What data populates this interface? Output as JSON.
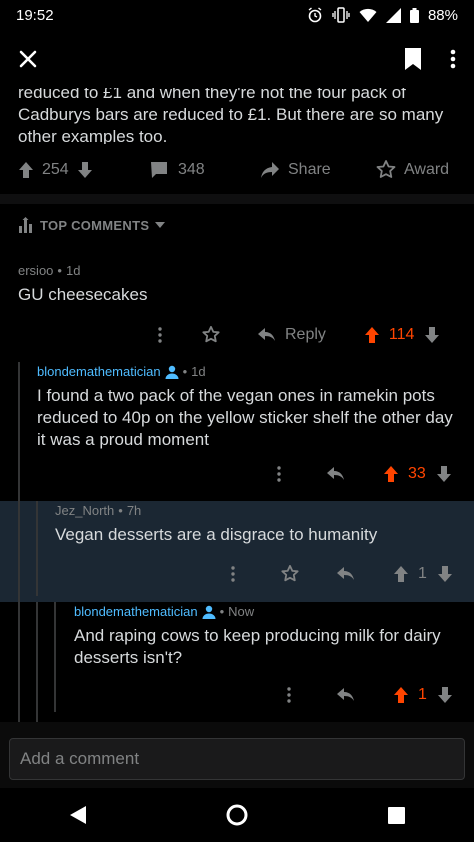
{
  "status_bar": {
    "time": "19:52",
    "battery": "88%"
  },
  "post": {
    "body_lines": [
      "reduced to £1 and when they're not the four pack of",
      "Cadburys bars are reduced to £1. But there are so many",
      "other examples too."
    ],
    "upvotes": "254",
    "comments": "348",
    "share_label": "Share",
    "award_label": "Award"
  },
  "sort": {
    "label": "TOP COMMENTS"
  },
  "comments": [
    {
      "author": "ersioo",
      "age": "1d",
      "text": "GU cheesecakes",
      "reply_label": "Reply",
      "score": "114"
    },
    {
      "author": "blondemathematician",
      "age": "1d",
      "text_lines": [
        "I found a two pack of the vegan ones in ramekin pots",
        "reduced to 40p on the yellow sticker shelf the other day",
        "it was a proud moment"
      ],
      "score": "33"
    },
    {
      "author": "Jez_North",
      "age": "7h",
      "text": "Vegan desserts are a disgrace to humanity",
      "score": "1"
    },
    {
      "author": "blondemathematician",
      "age": "Now",
      "text_lines": [
        "And raping cows to keep producing milk for dairy",
        "desserts isn't?"
      ],
      "score": "1"
    }
  ],
  "composer": {
    "placeholder": "Add a comment"
  },
  "colors": {
    "upvote": "#ff4500",
    "username": "#4fbcff",
    "highlight": "#1b2733"
  }
}
